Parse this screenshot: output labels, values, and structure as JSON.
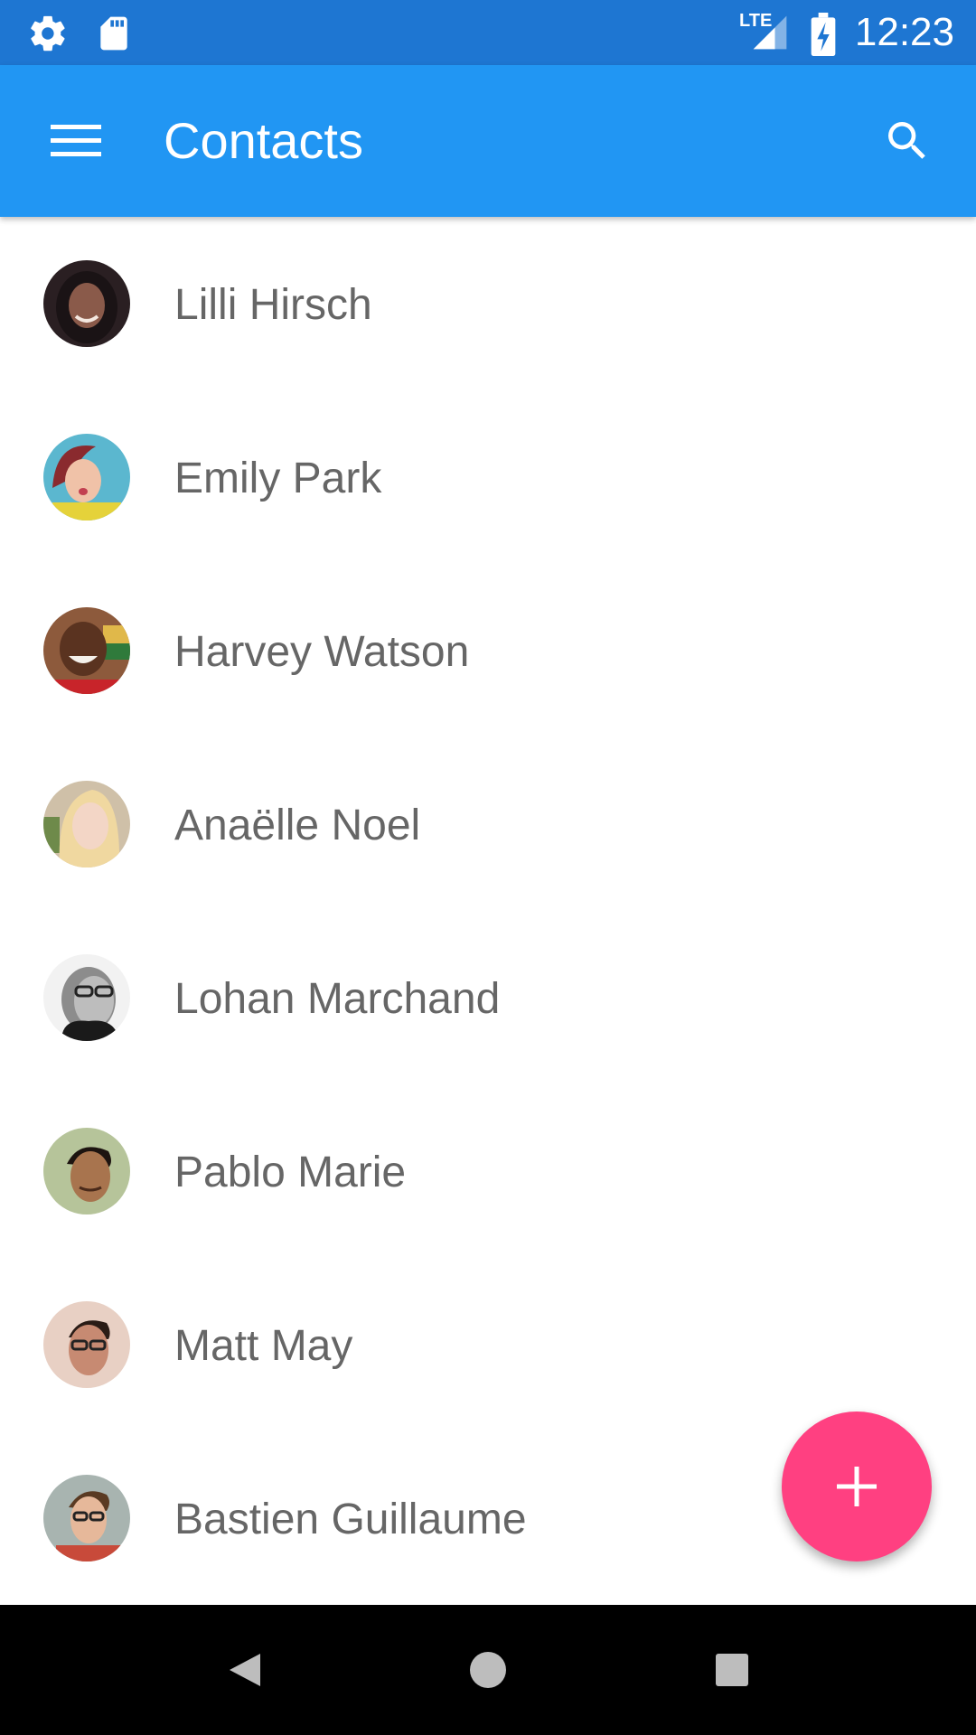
{
  "status_bar": {
    "time": "12:23",
    "network_label": "LTE",
    "icons": [
      "settings-icon",
      "sd-card-icon",
      "signal-icon",
      "battery-charging-icon"
    ]
  },
  "app_bar": {
    "title": "Contacts",
    "menu_icon": "hamburger-menu-icon",
    "search_icon": "search-icon",
    "color": "#2196f3"
  },
  "contacts": [
    {
      "name": "Lilli Hirsch"
    },
    {
      "name": "Emily Park"
    },
    {
      "name": "Harvey Watson"
    },
    {
      "name": "Anaëlle Noel"
    },
    {
      "name": "Lohan Marchand"
    },
    {
      "name": "Pablo Marie"
    },
    {
      "name": "Matt May"
    },
    {
      "name": "Bastien Guillaume"
    }
  ],
  "fab": {
    "icon": "add-icon",
    "color": "#ff4081"
  },
  "nav_bar": {
    "icons": [
      "back-icon",
      "home-icon",
      "recents-icon"
    ]
  }
}
